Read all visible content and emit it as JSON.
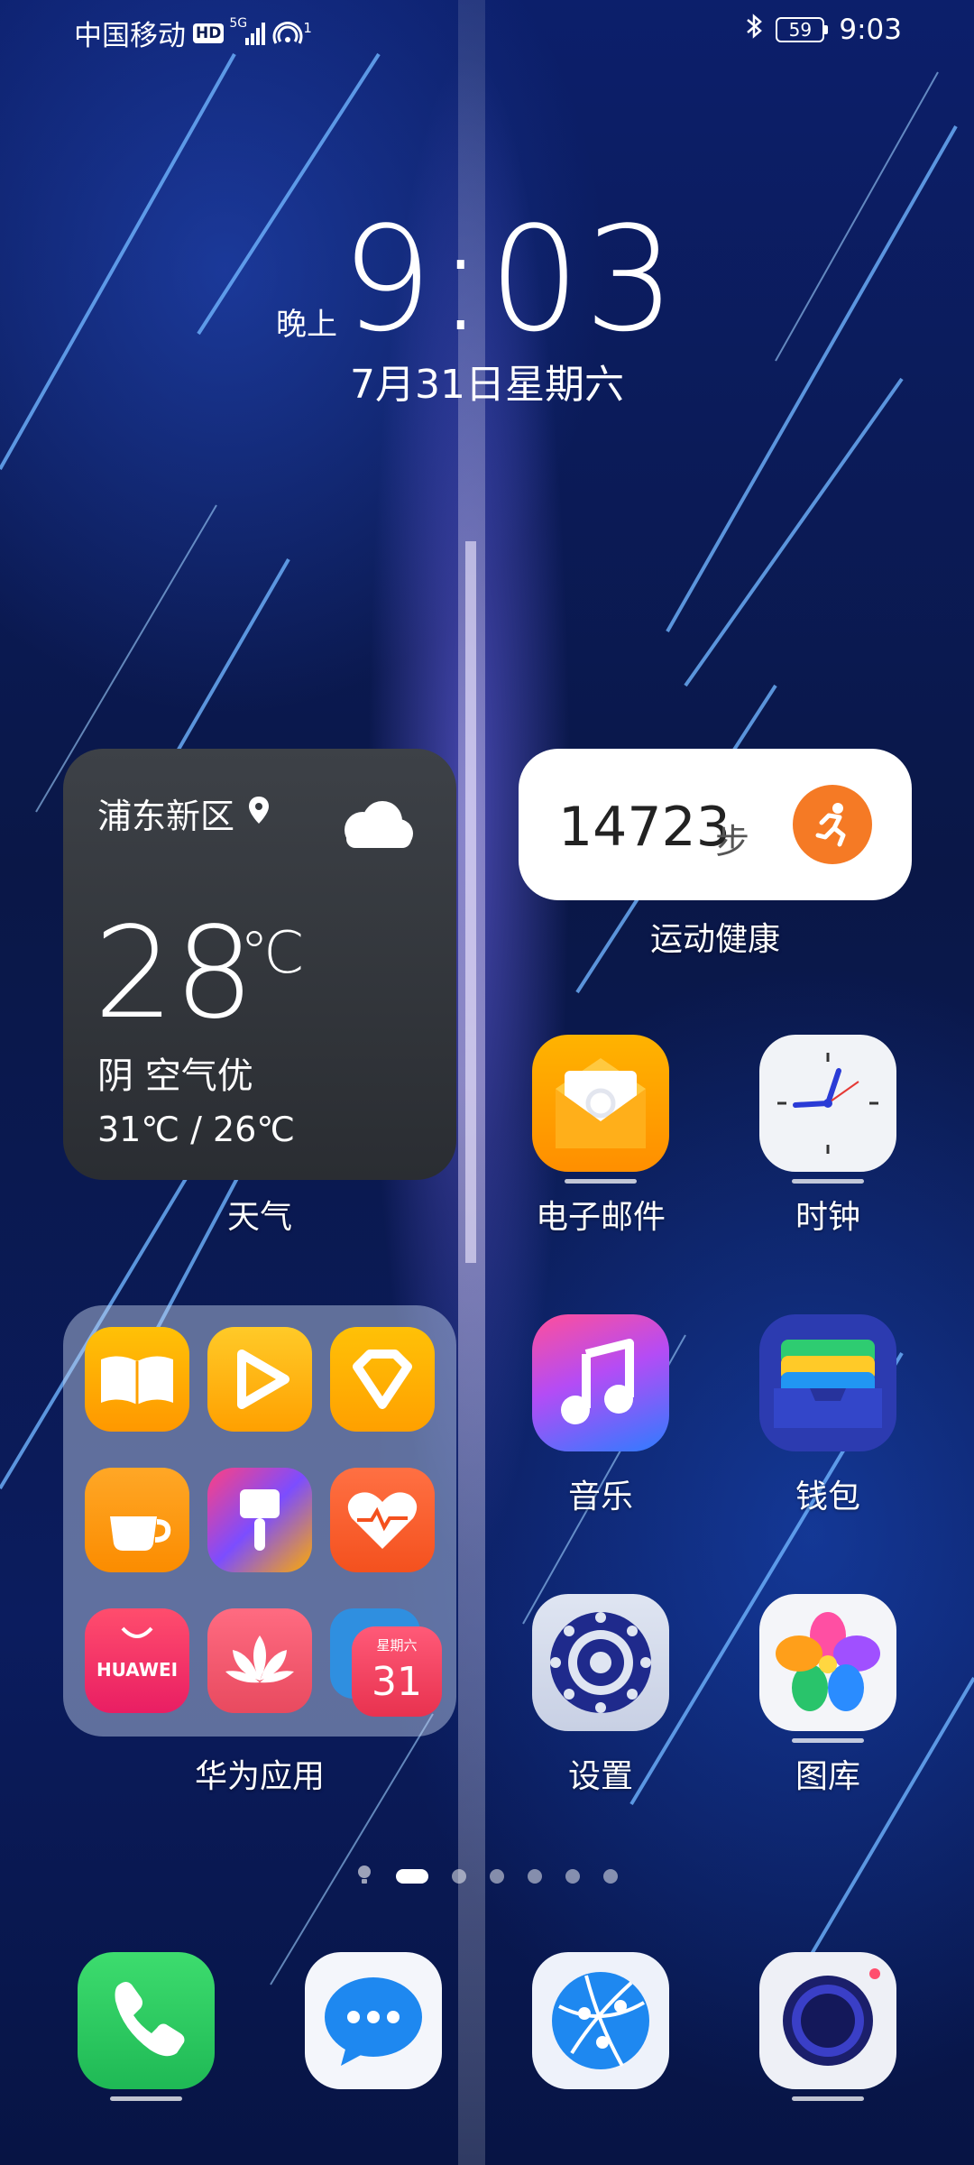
{
  "status_bar": {
    "carrier": "中国移动",
    "hd_badge": "HD",
    "network": "5G",
    "hotspot_count": "1",
    "battery": "59",
    "time": "9:03"
  },
  "lockclock": {
    "time": "9:03",
    "ampm": "晚上",
    "date": "7月31日星期六"
  },
  "weather_widget": {
    "location": "浦东新区",
    "temperature": "28",
    "unit": "℃",
    "condition": "阴 空气优",
    "range": "31℃ / 26℃",
    "label": "天气"
  },
  "steps_widget": {
    "count": "14723",
    "unit": "步",
    "label": "运动健康"
  },
  "apps": {
    "email": "电子邮件",
    "clock": "时钟",
    "music": "音乐",
    "wallet": "钱包",
    "settings": "设置",
    "gallery": "图库"
  },
  "folder": {
    "label": "华为应用",
    "huawei_text": "HUAWEI",
    "calendar_weekday": "星期六",
    "calendar_day": "31"
  },
  "page_indicator": {
    "count": 6,
    "active": 0
  },
  "dock": [
    "phone",
    "messages",
    "browser",
    "camera"
  ]
}
